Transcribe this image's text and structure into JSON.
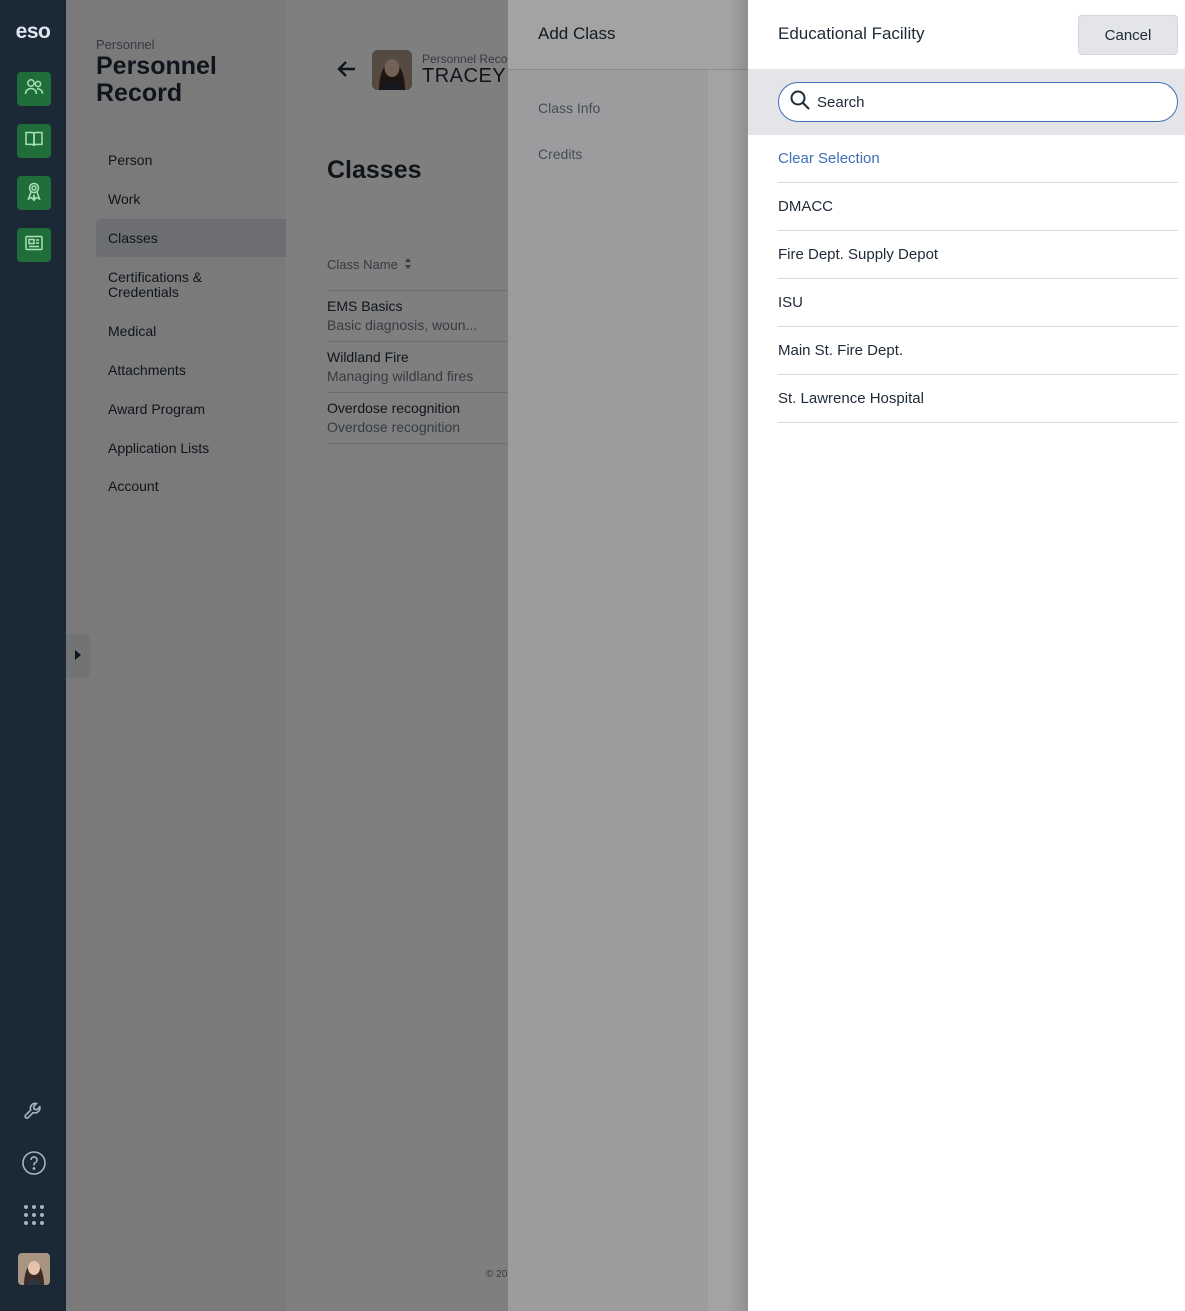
{
  "rail": {
    "logo": "eso",
    "icons": [
      "people-icon",
      "book-icon",
      "award-icon",
      "newspaper-icon",
      "wrench-icon",
      "help-icon",
      "apps-grid-icon"
    ]
  },
  "nav": {
    "kicker": "Personnel",
    "title": "Personnel Record",
    "items": [
      {
        "label": "Person"
      },
      {
        "label": "Work"
      },
      {
        "label": "Classes"
      },
      {
        "label": "Certifications & Credentials"
      },
      {
        "label": "Medical"
      },
      {
        "label": "Attachments"
      },
      {
        "label": "Award Program"
      },
      {
        "label": "Application Lists"
      },
      {
        "label": "Account"
      }
    ]
  },
  "record": {
    "kicker": "Personnel Reco",
    "name": "TRACEY Y",
    "section_title": "Classes",
    "column_header": "Class Name",
    "classes": [
      {
        "name": "EMS Basics",
        "description": "Basic diagnosis, woun..."
      },
      {
        "name": "Wildland Fire",
        "description": "Managing wildland fires"
      },
      {
        "name": "Overdose recognition",
        "description": "Overdose recognition"
      }
    ],
    "footer": "© 20"
  },
  "add_class": {
    "title": "Add Class",
    "nav": [
      "Class Info",
      "Credits"
    ]
  },
  "picker": {
    "title": "Educational Facility",
    "cancel_label": "Cancel",
    "search_placeholder": "Search",
    "clear_label": "Clear Selection",
    "options": [
      "DMACC",
      "Fire Dept. Supply Depot",
      "ISU",
      "Main St. Fire Dept.",
      "St. Lawrence Hospital"
    ]
  },
  "colors": {
    "rail_bg": "#1b2836",
    "rail_active": "#1f6e3a",
    "link_blue": "#3f6fb6"
  }
}
